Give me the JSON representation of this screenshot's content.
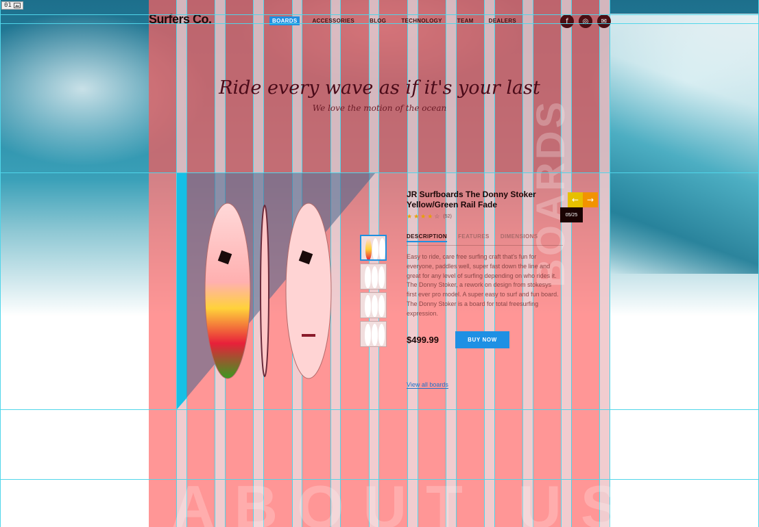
{
  "frame_badge": {
    "label": "01"
  },
  "header": {
    "logo": "Surfers Co.",
    "nav": [
      {
        "label": "BOARDS",
        "active": true
      },
      {
        "label": "ACCESSORIES",
        "active": false
      },
      {
        "label": "BLOG",
        "active": false
      },
      {
        "label": "TECHNOLOGY",
        "active": false
      },
      {
        "label": "TEAM",
        "active": false
      },
      {
        "label": "DEALERS",
        "active": false
      }
    ],
    "socials": [
      {
        "icon": "facebook-icon",
        "glyph": "f"
      },
      {
        "icon": "instagram-icon",
        "glyph": "◎"
      },
      {
        "icon": "mail-icon",
        "glyph": "✉"
      }
    ]
  },
  "hero": {
    "tagline": "Ride every wave as if it's your last",
    "subtagline": "We love the motion of the ocean"
  },
  "product": {
    "title": "JR Surfboards The Donny Stoker Yellow/Green Rail Fade",
    "rating_stars": 4,
    "rating_max": 5,
    "rating_count": "(52)",
    "tabs": [
      "DESCRIPTION",
      "FEATURES",
      "DIMENSIONS"
    ],
    "active_tab": 0,
    "description": "Easy to ride, care free surfing craft that's fun for everyone, paddles well, super fast down the line and great for any level of surfing depending on who rides it. The Donny Stoker, a rework on design from stokesys first ever pro model. A super easy to surf and fun board. The Donny Stoker is a board for total freesurfing expression.",
    "price": "$499.99",
    "buy_label": "BUY NOW",
    "view_all": "View all boards",
    "thumbnail_count": 4
  },
  "slider": {
    "counter": "05/25",
    "prev_icon": "arrow-left-icon",
    "next_icon": "arrow-right-icon",
    "prev_color": "#e6c000",
    "next_color": "#f29300"
  },
  "background_words": {
    "vertical": "BOARDS",
    "bottom": "ABOUT US"
  },
  "colors": {
    "accent": "#1e90e4",
    "overlay": "#ff7878",
    "guides": "#4fd6ea"
  }
}
